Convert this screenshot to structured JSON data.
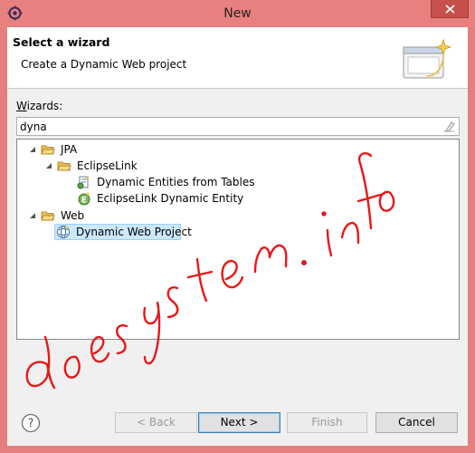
{
  "window": {
    "title": "New"
  },
  "banner": {
    "title": "Select a wizard",
    "description": "Create a Dynamic Web project"
  },
  "wizards": {
    "label_prefix": "",
    "label_mnemonic": "W",
    "label_rest": "izards:",
    "filter_value": "dyna"
  },
  "tree": {
    "items": [
      {
        "label": "JPA",
        "icon": "folder-open-icon"
      },
      {
        "label": "EclipseLink",
        "icon": "folder-open-icon"
      },
      {
        "label": "Dynamic Entities from Tables",
        "icon": "entities-wizard-icon"
      },
      {
        "label": "EclipseLink Dynamic Entity",
        "icon": "entity-wizard-icon"
      },
      {
        "label": "Web",
        "icon": "folder-open-icon"
      },
      {
        "label": "Dynamic Web Project",
        "icon": "web-project-icon",
        "selected": true
      }
    ]
  },
  "buttons": {
    "back": "< Back",
    "next": "Next >",
    "finish": "Finish",
    "cancel": "Cancel"
  },
  "watermark": {
    "text": "doesystem.info",
    "color": "#e81818"
  },
  "colors": {
    "frame": "#e8807f",
    "close": "#c7504c",
    "selection": "#cce8ff"
  }
}
